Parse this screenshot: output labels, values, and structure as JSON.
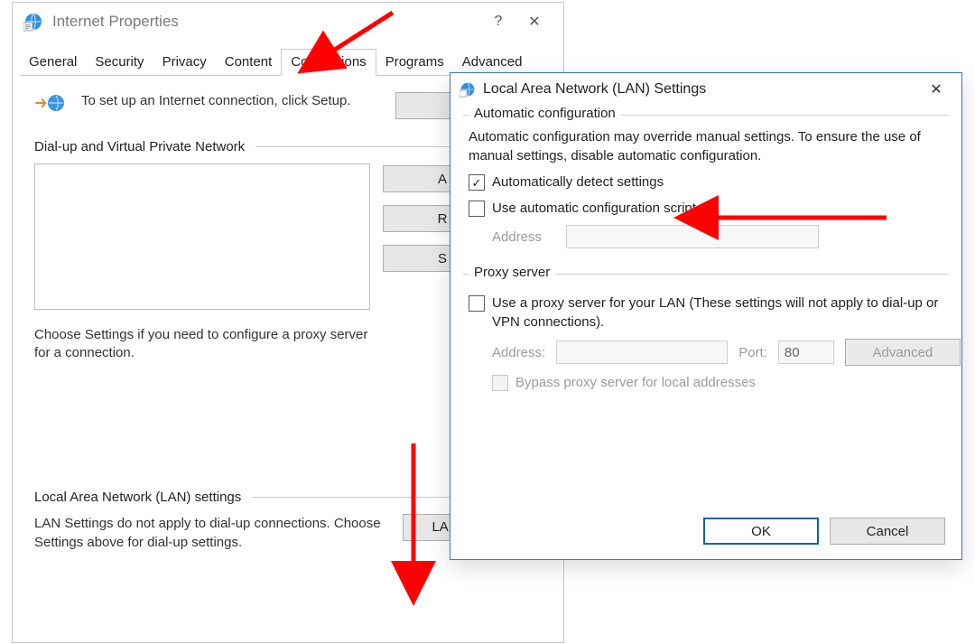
{
  "ip": {
    "title": "Internet Properties",
    "help_glyph": "?",
    "close_glyph": "✕",
    "tabs": [
      "General",
      "Security",
      "Privacy",
      "Content",
      "Connections",
      "Programs",
      "Advanced"
    ],
    "active_tab_index": 4,
    "setup_text": "To set up an Internet connection, click Setup.",
    "dialup_heading": "Dial-up and Virtual Private Network",
    "btn_add": "A",
    "btn_remove": "R",
    "btn_settings": "S",
    "choose_text": "Choose Settings if you need to configure a proxy server for a connection.",
    "lan_heading": "Local Area Network (LAN) settings",
    "lan_desc": "LAN Settings do not apply to dial-up connections. Choose Settings above for dial-up settings.",
    "btn_lan": "LAN settings"
  },
  "lan": {
    "title": "Local Area Network (LAN) Settings",
    "close_glyph": "✕",
    "auto": {
      "legend": "Automatic configuration",
      "desc": "Automatic configuration may override manual settings.  To ensure the use of manual settings, disable automatic configuration.",
      "detect_label": "Automatically detect settings",
      "detect_checked": true,
      "script_label": "Use automatic configuration script",
      "script_checked": false,
      "address_label": "Address",
      "address_value": ""
    },
    "proxy": {
      "legend": "Proxy server",
      "use_label": "Use a proxy server for your LAN (These settings will not apply to dial-up or VPN connections).",
      "use_checked": false,
      "address_label": "Address:",
      "address_value": "",
      "port_label": "Port:",
      "port_value": "80",
      "advanced_label": "Advanced",
      "bypass_label": "Bypass proxy server for local addresses",
      "bypass_checked": false
    },
    "ok_label": "OK",
    "cancel_label": "Cancel"
  }
}
